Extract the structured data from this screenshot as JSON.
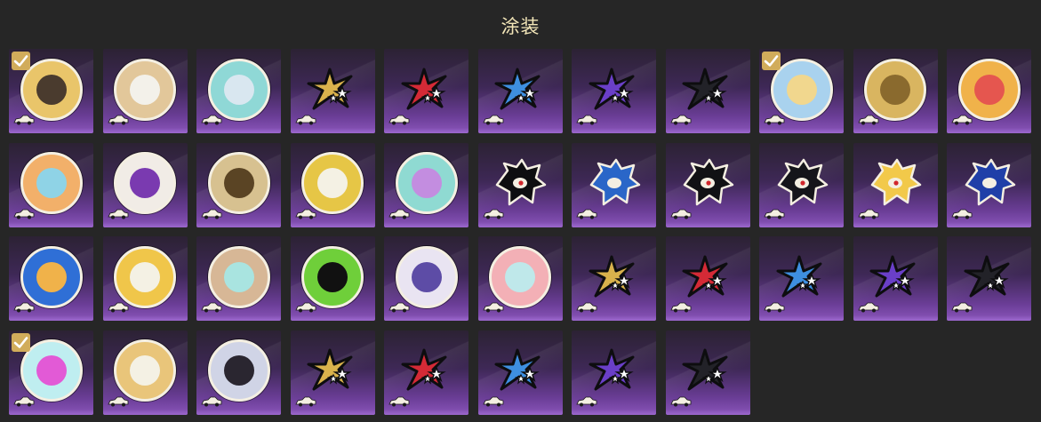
{
  "page": {
    "title": "涂装"
  },
  "colors": {
    "background": "#262626",
    "title": "#f3e6b8",
    "selected_badge": "#d1ac5b"
  },
  "skins": [
    {
      "kind": "disc",
      "icon": "character-portrait-disc-icon",
      "color": "#e9c56a",
      "inner": "#4a3b2e",
      "selected": true
    },
    {
      "kind": "disc",
      "icon": "white-creature-disc-icon",
      "color": "#e2c79a",
      "inner": "#f3f1ea",
      "selected": false
    },
    {
      "kind": "disc",
      "icon": "teal-rainbow-disc-icon",
      "color": "#8fd8d6",
      "inner": "#d9e7f0",
      "selected": false
    },
    {
      "kind": "stars",
      "icon": "gold-stars-icon",
      "color": "#d9b24c",
      "selected": false
    },
    {
      "kind": "stars",
      "icon": "red-stars-icon",
      "color": "#d42a36",
      "selected": false
    },
    {
      "kind": "stars",
      "icon": "blue-stars-icon",
      "color": "#3e8fe0",
      "selected": false
    },
    {
      "kind": "stars",
      "icon": "purple-stars-icon",
      "color": "#6a3fc8",
      "selected": false
    },
    {
      "kind": "stars",
      "icon": "black-stars-icon",
      "color": "#222228",
      "selected": false
    },
    {
      "kind": "disc",
      "icon": "blonde-character-disc-icon",
      "color": "#a9d2ee",
      "inner": "#f1d78e",
      "selected": true
    },
    {
      "kind": "disc",
      "icon": "golden-emblem-disc-icon",
      "color": "#d9b560",
      "inner": "#8a6a2e",
      "selected": false
    },
    {
      "kind": "disc",
      "icon": "colorful-characters-disc-icon",
      "color": "#f0b24a",
      "inner": "#e5564f",
      "selected": false
    },
    {
      "kind": "disc",
      "icon": "crystal-spiky-disc-icon",
      "color": "#f2b06a",
      "inner": "#8fd3e6",
      "selected": false
    },
    {
      "kind": "disc",
      "icon": "swirl-stripes-disc-icon",
      "color": "#f1ece6",
      "inner": "#7a3ab0",
      "selected": false
    },
    {
      "kind": "disc",
      "icon": "golden-claw-disc-icon",
      "color": "#d7c190",
      "inner": "#5a4424",
      "selected": false
    },
    {
      "kind": "disc",
      "icon": "plush-girl-disc-icon",
      "color": "#e6c646",
      "inner": "#f4f1e4",
      "selected": false
    },
    {
      "kind": "disc",
      "icon": "teal-splash-disc-icon",
      "color": "#8fdad2",
      "inner": "#c38de0",
      "selected": false
    },
    {
      "kind": "head",
      "icon": "black-hedgehog-icon",
      "color": "#0e0e10",
      "accent": "#d1262b",
      "selected": false
    },
    {
      "kind": "head",
      "icon": "blue-hedgehog-icon",
      "color": "#2a66c8",
      "accent": "#f4efe2",
      "selected": false
    },
    {
      "kind": "head",
      "icon": "black-cat-mask-icon",
      "color": "#111114",
      "accent": "#d1262b",
      "selected": false
    },
    {
      "kind": "head",
      "icon": "phantom-thief-icon",
      "color": "#15151a",
      "accent": "#d1262b",
      "selected": false
    },
    {
      "kind": "head",
      "icon": "blonde-android-icon",
      "color": "#f2c94a",
      "accent": "#d1262b",
      "selected": false
    },
    {
      "kind": "head",
      "icon": "blue-hair-boy-icon",
      "color": "#1f3fa8",
      "accent": "#f4efe2",
      "selected": false
    },
    {
      "kind": "disc",
      "icon": "penguin-bird-disc-icon",
      "color": "#2f6fd6",
      "inner": "#f0b24a",
      "selected": false
    },
    {
      "kind": "disc",
      "icon": "cow-creature-disc-icon",
      "color": "#f0c64a",
      "inner": "#f4f1e4",
      "selected": false
    },
    {
      "kind": "disc",
      "icon": "ghost-bunny-disc-icon",
      "color": "#d7b796",
      "inner": "#a9e4e0",
      "selected": false
    },
    {
      "kind": "disc",
      "icon": "green-flame-disc-icon",
      "color": "#6fcf3a",
      "inner": "#111111",
      "selected": false
    },
    {
      "kind": "disc",
      "icon": "purple-emblem-disc-icon",
      "color": "#e9e4f2",
      "inner": "#5d4ca6",
      "selected": false
    },
    {
      "kind": "disc",
      "icon": "pink-bunny-disc-icon",
      "color": "#f3b0b6",
      "inner": "#bfe8ea",
      "selected": false
    },
    {
      "kind": "stars",
      "icon": "gold-stars-icon",
      "color": "#d9b24c",
      "selected": false
    },
    {
      "kind": "stars",
      "icon": "red-stars-icon",
      "color": "#d42a36",
      "selected": false
    },
    {
      "kind": "stars",
      "icon": "blue-stars-icon",
      "color": "#3e8fe0",
      "selected": false
    },
    {
      "kind": "stars",
      "icon": "purple-stars-icon",
      "color": "#6a3fc8",
      "selected": false
    },
    {
      "kind": "stars",
      "icon": "black-stars-icon",
      "color": "#222228",
      "selected": false
    },
    {
      "kind": "disc",
      "icon": "pink-cat-disc-icon",
      "color": "#bfeef0",
      "inner": "#e25ad6",
      "selected": true
    },
    {
      "kind": "disc",
      "icon": "white-dog-disc-icon",
      "color": "#e9c57a",
      "inner": "#f4f1e4",
      "selected": false
    },
    {
      "kind": "disc",
      "icon": "dark-hair-character-disc-icon",
      "color": "#d0d4e6",
      "inner": "#2a2630",
      "selected": false
    },
    {
      "kind": "stars",
      "icon": "gold-stars-icon",
      "color": "#d9b24c",
      "selected": false
    },
    {
      "kind": "stars",
      "icon": "red-stars-icon",
      "color": "#d42a36",
      "selected": false
    },
    {
      "kind": "stars",
      "icon": "blue-stars-icon",
      "color": "#3e8fe0",
      "selected": false
    },
    {
      "kind": "stars",
      "icon": "purple-stars-icon",
      "color": "#6a3fc8",
      "selected": false
    },
    {
      "kind": "stars",
      "icon": "black-stars-icon",
      "color": "#222228",
      "selected": false
    }
  ]
}
